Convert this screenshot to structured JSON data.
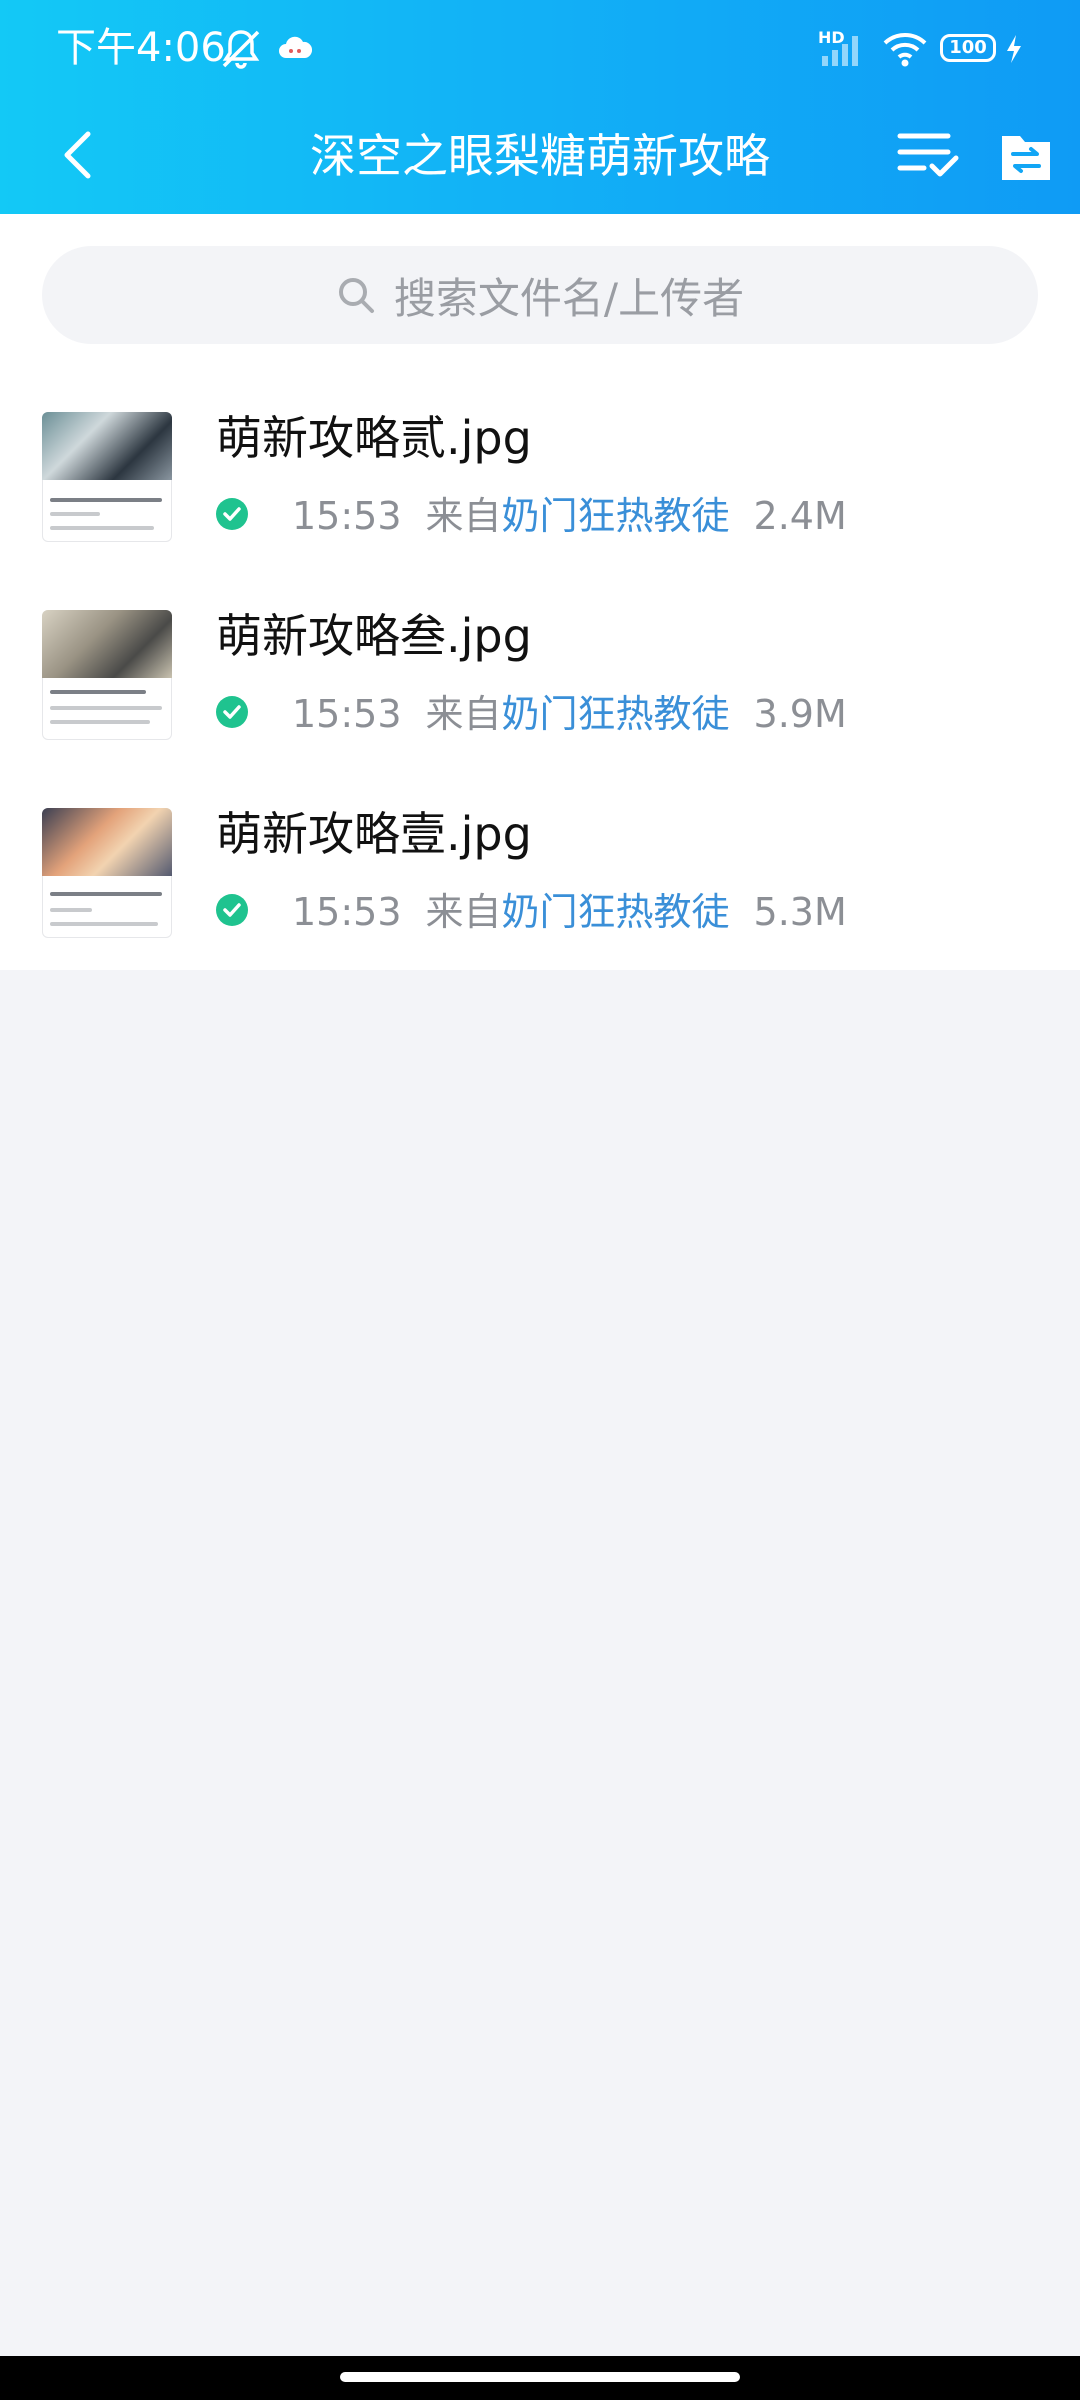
{
  "status_bar": {
    "time": "下午4:06",
    "battery": "100",
    "network_badge": "HD",
    "icons": [
      "mute-bell-icon",
      "cloud-app-icon",
      "signal-icon",
      "wifi-icon",
      "battery-icon",
      "charging-icon"
    ]
  },
  "header": {
    "title": "深空之眼梨糖萌新攻略",
    "icons": [
      "back-arrow-icon",
      "multi-select-icon",
      "folder-transfer-icon"
    ],
    "gradient": [
      "#13c9f6",
      "#0f9bf5"
    ]
  },
  "search": {
    "placeholder": "搜索文件名/上传者"
  },
  "files": [
    {
      "name": "萌新攻略贰.jpg",
      "time": "15:53",
      "from_label": "来自",
      "uploader": "奶门狂热教徒",
      "size": "2.4M"
    },
    {
      "name": "萌新攻略叁.jpg",
      "time": "15:53",
      "from_label": "来自",
      "uploader": "奶门狂热教徒",
      "size": "3.9M"
    },
    {
      "name": "萌新攻略壹.jpg",
      "time": "15:53",
      "from_label": "来自",
      "uploader": "奶门狂热教徒",
      "size": "5.3M"
    }
  ],
  "colors": {
    "accent": "#12b2f6",
    "uploader_link": "#3a8fd8",
    "success_check": "#1fc38f",
    "background": "#f3f4f8"
  }
}
